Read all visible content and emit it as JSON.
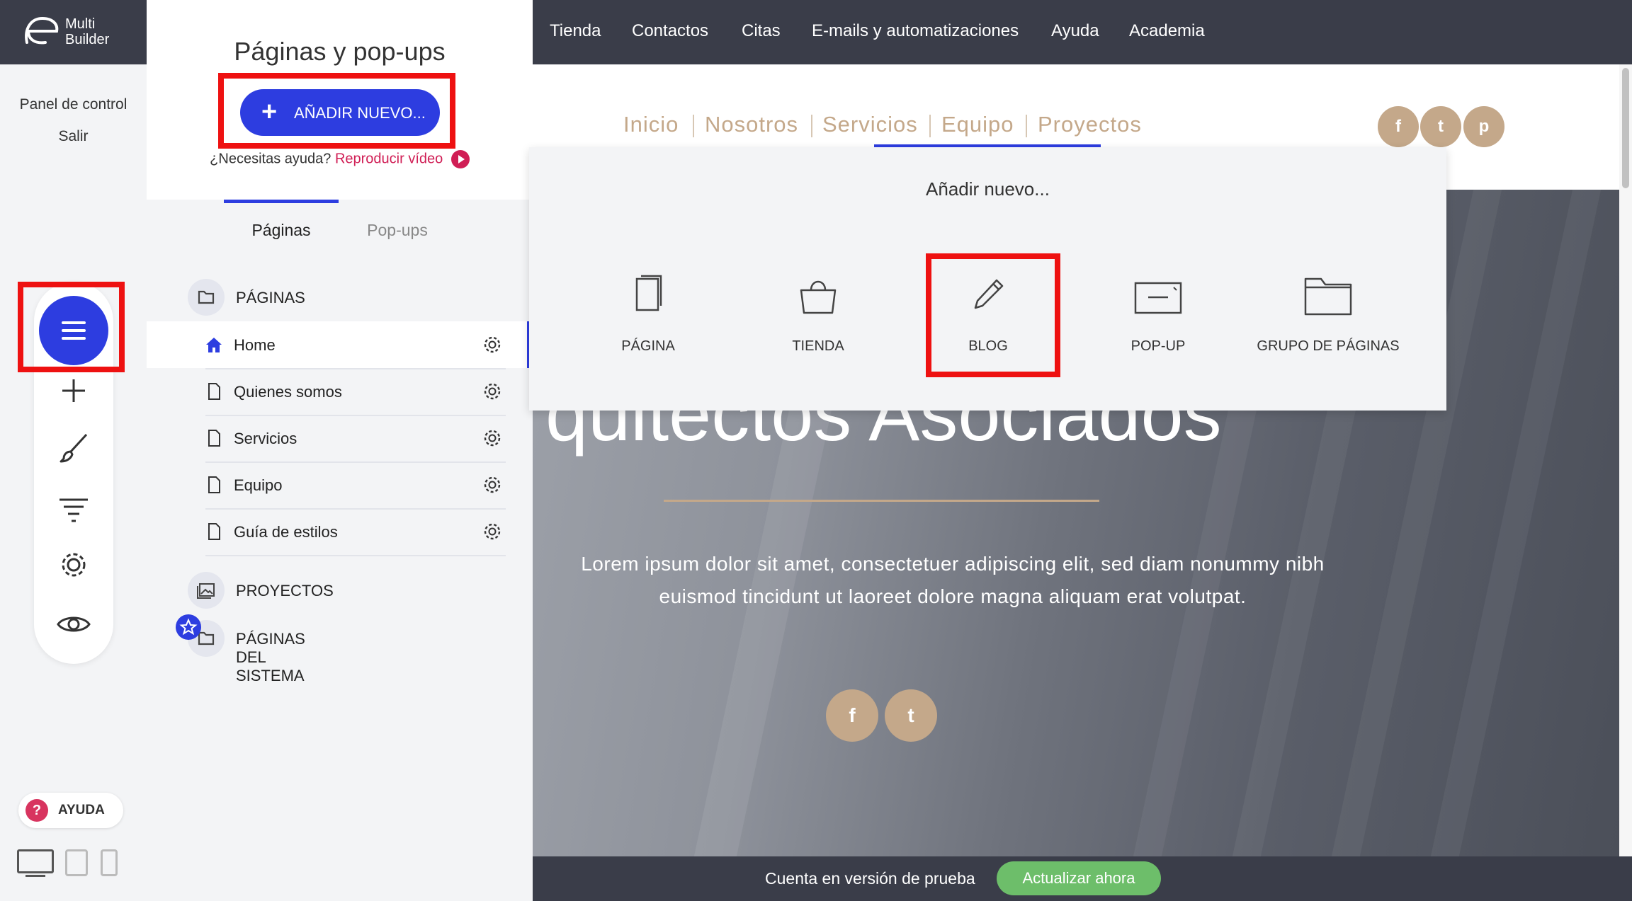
{
  "brand": {
    "line1": "Multi",
    "line2": "Builder"
  },
  "left_links": {
    "dashboard": "Panel de control",
    "logout": "Salir"
  },
  "help_button": {
    "icon": "?",
    "label": "AYUDA"
  },
  "panel": {
    "title": "Páginas y pop-ups",
    "add_new_label": "AÑADIR NUEVO...",
    "help_question": "¿Necesitas ayuda?",
    "help_video": "Reproducir vídeo",
    "tabs": [
      {
        "label": "Páginas",
        "active": true
      },
      {
        "label": "Pop-ups",
        "active": false
      }
    ],
    "sections": {
      "pages": "PÁGINAS",
      "projects": "PROYECTOS",
      "system": "PÁGINAS DEL SISTEMA"
    },
    "pages": [
      {
        "label": "Home",
        "icon": "home-icon"
      },
      {
        "label": "Quienes somos",
        "icon": "page-icon"
      },
      {
        "label": "Servicios",
        "icon": "page-icon"
      },
      {
        "label": "Equipo",
        "icon": "page-icon"
      },
      {
        "label": "Guía de estilos",
        "icon": "page-icon"
      }
    ]
  },
  "topnav": [
    "Tienda",
    "Contactos",
    "Citas",
    "E-mails y automatizaciones",
    "Ayuda",
    "Academia"
  ],
  "site": {
    "nav": [
      "Inicio",
      "Nosotros",
      "Servicios",
      "Equipo",
      "Proyectos"
    ],
    "social_top": [
      "f",
      "t",
      "p"
    ],
    "hero_title": "quitectos Asociados",
    "hero_text": "Lorem ipsum dolor sit amet, consectetuer adipiscing elit, sed diam nonummy nibh euismod tincidunt ut laoreet dolore magna aliquam erat volutpat.",
    "social_bottom": [
      "f",
      "t"
    ]
  },
  "popover": {
    "title": "Añadir nuevo...",
    "items": [
      "PÁGINA",
      "TIENDA",
      "BLOG",
      "POP-UP",
      "GRUPO DE PÁGINAS"
    ]
  },
  "bottom": {
    "trial": "Cuenta en versión de prueba",
    "upgrade": "Actualizar ahora"
  },
  "colors": {
    "accent": "#2d3de0",
    "highlight": "#ee1111",
    "dark": "#3a3d49",
    "gold": "#c4a88a",
    "green": "#6dbe6a",
    "video": "#d01e55"
  }
}
